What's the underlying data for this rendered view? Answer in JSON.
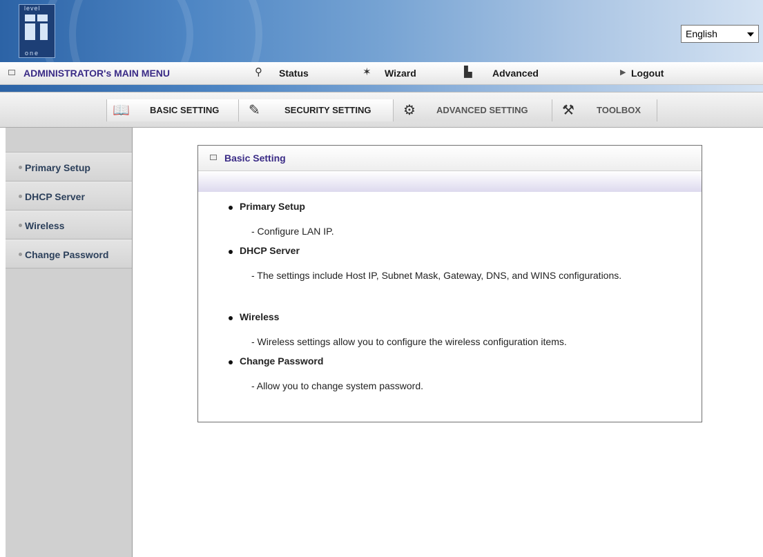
{
  "header": {
    "logo": {
      "top_text": "level",
      "bottom_text": "one",
      "icon": "levelone-logo-icon"
    },
    "language": {
      "selected": "English",
      "icon": "chevron-down-icon"
    }
  },
  "main_menu": {
    "admin_label": "ADMINISTRATOR's MAIN MENU",
    "items": [
      {
        "label": "Status",
        "icon": "status-icon"
      },
      {
        "label": "Wizard",
        "icon": "wizard-icon"
      },
      {
        "label": "Advanced",
        "icon": "advanced-icon"
      },
      {
        "label": "Logout",
        "icon": "triangle-right-icon"
      }
    ]
  },
  "tabs": [
    {
      "label": "BASIC SETTING",
      "icon": "book-icon",
      "active": true
    },
    {
      "label": "SECURITY SETTING",
      "icon": "lock-icon",
      "active": false
    },
    {
      "label": "ADVANCED SETTING",
      "icon": "gear-icon",
      "active": false
    },
    {
      "label": "TOOLBOX",
      "icon": "toolbox-icon",
      "active": false
    }
  ],
  "sidebar": {
    "items": [
      {
        "label": "Primary Setup"
      },
      {
        "label": "DHCP Server"
      },
      {
        "label": "Wireless"
      },
      {
        "label": "Change Password"
      }
    ]
  },
  "panel": {
    "title": "Basic Setting",
    "entries": [
      {
        "heading": "Primary Setup",
        "description": "- Configure LAN IP."
      },
      {
        "heading": "DHCP Server",
        "description": "- The settings include Host IP, Subnet Mask, Gateway, DNS, and WINS configurations."
      },
      {
        "heading": "Wireless",
        "description": "- Wireless settings allow you to configure the wireless configuration items."
      },
      {
        "heading": "Change Password",
        "description": "- Allow you to change system password."
      }
    ]
  },
  "colors": {
    "accent_purple": "#3a2b86",
    "banner_blue": "#2c63a6",
    "sidebar_gray": "#d0d0d0"
  }
}
